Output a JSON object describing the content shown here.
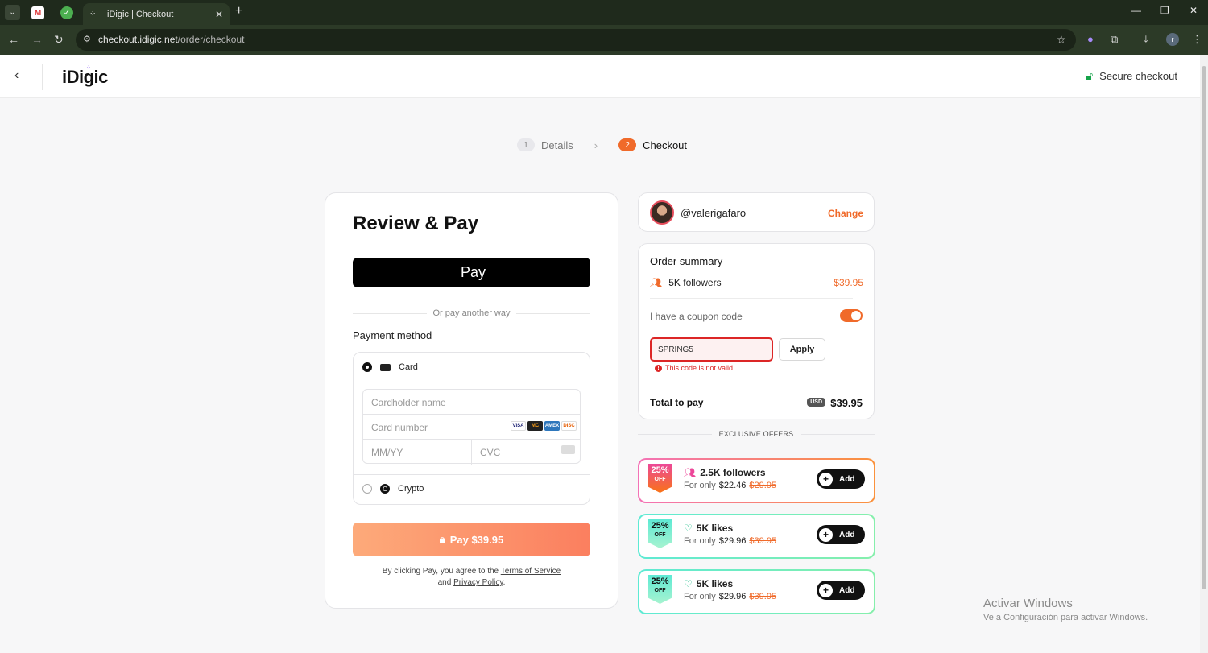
{
  "browser": {
    "tab_title": "iDigic | Checkout",
    "url_domain": "checkout.idigic.net",
    "url_path": "/order/checkout"
  },
  "header": {
    "logo": "iDigic",
    "secure_label": "Secure checkout"
  },
  "stepper": {
    "steps": [
      {
        "num": "1",
        "label": "Details"
      },
      {
        "num": "2",
        "label": "Checkout"
      }
    ]
  },
  "pay": {
    "title": "Review & Pay",
    "apple_pay_label": "Pay",
    "or_text": "Or pay another way",
    "payment_method_label": "Payment method",
    "card_label": "Card",
    "cardholder_placeholder": "Cardholder name",
    "card_number_placeholder": "Card number",
    "expiry_placeholder": "MM/YY",
    "cvc_placeholder": "CVC",
    "crypto_label": "Crypto",
    "card_brands": [
      "VISA",
      "MC",
      "AMEX",
      "DISC"
    ],
    "pay_button": "Pay $39.95",
    "terms_prefix": "By clicking Pay, you agree to the",
    "terms_link": "Terms of Service",
    "terms_and": "and",
    "privacy_link": "Privacy Policy",
    "terms_suffix": "."
  },
  "user": {
    "handle": "@valerigafaro",
    "change_label": "Change"
  },
  "summary": {
    "title": "Order summary",
    "item_label": "5K followers",
    "item_price": "$39.95",
    "coupon_label": "I have a coupon code",
    "coupon_toggle_on": true,
    "coupon_value": "SPRING5",
    "apply_label": "Apply",
    "error": "This code is not valid.",
    "total_label": "Total to pay",
    "currency": "USD",
    "total_value": "$39.95"
  },
  "offers": {
    "heading": "EXCLUSIVE OFFERS",
    "for_only": "For only",
    "add_label": "Add",
    "items": [
      {
        "discount": "25%",
        "off": "OFF",
        "name": "2.5K followers",
        "price": "$22.46",
        "old_price": "$29.95",
        "accent": "#f472b6"
      },
      {
        "discount": "25%",
        "off": "OFF",
        "name": "5K likes",
        "price": "$29.96",
        "old_price": "$39.95",
        "accent": "#34d399"
      },
      {
        "discount": "25%",
        "off": "OFF",
        "name": "5K likes",
        "price": "$29.96",
        "old_price": "$39.95",
        "accent": "#34d399"
      }
    ]
  },
  "watermark": {
    "line1": "Activar Windows",
    "line2": "Ve a Configuración para activar Windows."
  },
  "colors": {
    "accent": "#f06a2a",
    "error": "#dc2626"
  }
}
